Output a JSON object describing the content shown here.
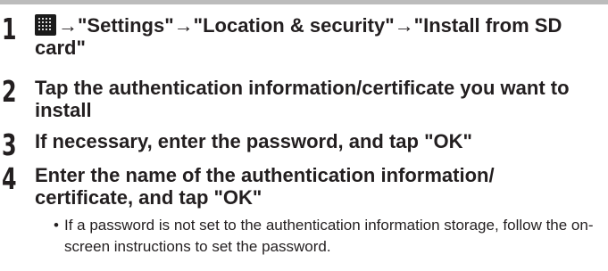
{
  "steps": [
    {
      "number": "1",
      "icon": "app-menu-icon",
      "text": "→\"Settings\"→\"Location & security\"→\"Install from SD card\""
    },
    {
      "number": "2",
      "text": "Tap the authentication information/certificate you want to install"
    },
    {
      "number": "3",
      "text": "If necessary, enter the password, and tap \"OK\""
    },
    {
      "number": "4",
      "text": "Enter the name of the authentication information/ certificate, and tap \"OK\""
    }
  ],
  "note": {
    "bullet": "•",
    "text": "If a password is not set to the authentication information storage, follow the on-screen instructions to set the password."
  }
}
